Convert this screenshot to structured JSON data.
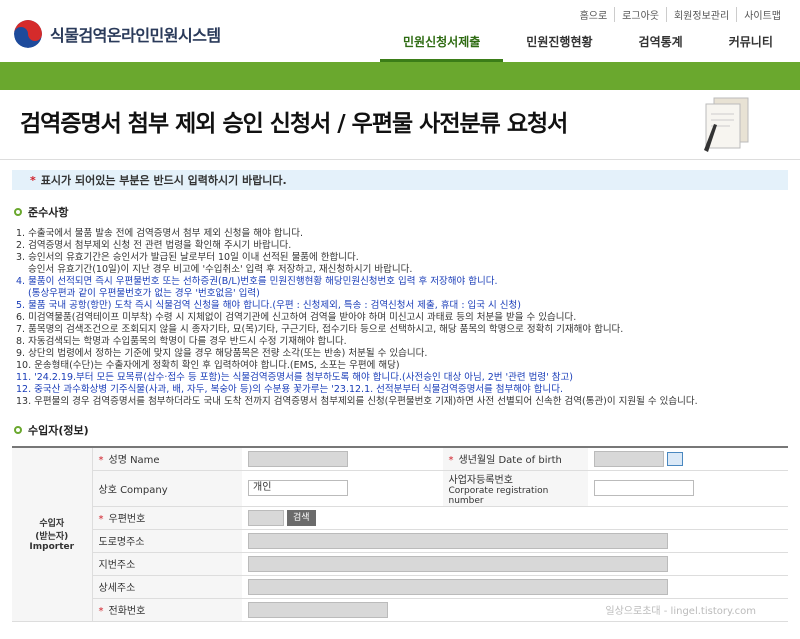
{
  "app": {
    "title": "식물검역온라인민원시스템"
  },
  "util_links": [
    "홈으로",
    "로그아웃",
    "회원정보관리",
    "사이트맵"
  ],
  "nav": [
    "민원신청서제출",
    "민원진행현황",
    "검역통계",
    "커뮤니티"
  ],
  "page_title": "검역증명서 첨부 제외 승인 신청서 / 우편물 사전분류 요청서",
  "notice": "표시가 되어있는 부분은 반드시 입력하시기 바랍니다.",
  "rules_title": "준수사항",
  "rules": [
    {
      "t": "1. 수출국에서 물품 발송 전에 검역증명서 첨부 제외 신청을 해야 합니다.",
      "c": ""
    },
    {
      "t": "2. 검역증명서 첨부제외 신청 전 관련 법령을 확인해 주시기 바랍니다.",
      "c": ""
    },
    {
      "t": "3. 승인서의 유효기간은 승인서가 발급된 날로부터 10일 이내 선적된 물품에 한합니다.",
      "c": ""
    },
    {
      "t": "승인서 유효기간(10일)이 지난 경우 비고에 '수입취소' 입력 후 저장하고, 재신청하시기 바랍니다.",
      "c": "ind"
    },
    {
      "t": "4. 물품이 선적되면 즉시 우편물번호 또는 선하증권(B/L)번호를 민원진행현황 해당민원신청번호 입력 후 저장해야 합니다.",
      "c": "blue"
    },
    {
      "t": "(통상우편과 같이 우편물번호가 없는 경우 '번호없음' 입력)",
      "c": "blue ind"
    },
    {
      "t": "5. 물품 국내 공항(항만) 도착 즉시 식물검역 신청을 해야 합니다.(우편 : 신청제외, 특송 : 검역신청서 제출, 휴대 : 입국 시 신청)",
      "c": "blue"
    },
    {
      "t": "6. 미검역물품(검역테이프 미부착) 수령 시 지체없이 검역기관에 신고하여 검역을 받아야 하며 미신고시 과태료 등의 처분을 받을 수 있습니다.",
      "c": ""
    },
    {
      "t": "7. 품목명의 검색조건으로 조회되지 않을 시 종자기타, 묘(목)기타, 구근기타, 접수기타 등으로 선택하시고, 해당 품목의 학명으로 정확히 기재해야 합니다.",
      "c": ""
    },
    {
      "t": "8. 자동검색되는 학명과 수입품목의 학명이 다를 경우 반드시 수정 기재해야 합니다.",
      "c": ""
    },
    {
      "t": "9. 상단의 법령에서 정하는 기준에 맞지 않을 경우 해당품목은 전량 소각(또는 반송) 처분될 수 있습니다.",
      "c": ""
    },
    {
      "t": "10. 운송형태(수단)는 수출자에게 정확히 확인 후 입력하여야 합니다.(EMS, 소포는 우편에 해당)",
      "c": ""
    },
    {
      "t": "11. '24.2.19.부터 모든 묘목류(삽수·접수 등 포함)는 식물검역증명서를 첨부하도록 해야 합니다.(사전승인 대상 아님, 2번 '관련 법령' 참고)",
      "c": "blue"
    },
    {
      "t": "12. 중국산 과수화상병 기주식물(사과, 배, 자두, 복숭아 등)의 수분용 꽃가루는 '23.12.1. 선적분부터 식물검역증명서를 첨부해야 합니다.",
      "c": "blue"
    },
    {
      "t": "13. 우편물의 경우 검역증명서를 첨부하더라도 국내 도착 전까지 검역증명서 첨부제외를 신청(우편물번호 기재)하면 사전 선별되어 신속한 검역(통관)이 지원될 수 있습니다.",
      "c": ""
    }
  ],
  "importer_title": "수입자(정보)",
  "importer_side": "수입자\n(받는자)\nImporter",
  "fields": {
    "name": "성명 Name",
    "dob": "생년월일 Date of birth",
    "company": "상호 Company",
    "company_value": "개인",
    "corp_no": "사업자등록번호",
    "corp_no_en": "Corporate registration number",
    "postal": "우편번호",
    "search_btn": "검색",
    "road_addr": "도로명주소",
    "lot_addr": "지번주소",
    "detail_addr": "상세주소",
    "phone": "전화번호"
  },
  "watermark": "일상으로초대 - lingel.tistory.com",
  "colors": {
    "brand_green": "#6aa82e",
    "required": "#d0202a",
    "blue_text": "#1a3db8"
  }
}
